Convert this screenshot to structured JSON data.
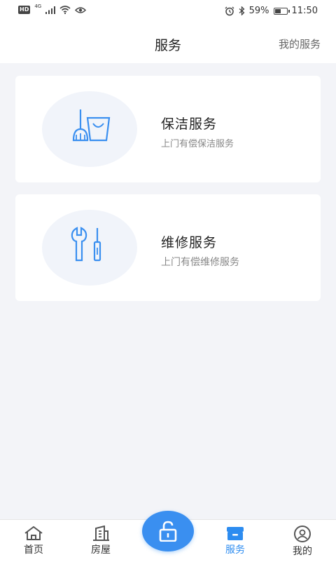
{
  "status_bar": {
    "hd_badge": "HD",
    "network": "4G",
    "battery_percent": "59%",
    "battery_level": 0.59,
    "time": "11:50"
  },
  "header": {
    "title": "服务",
    "action_label": "我的服务"
  },
  "services": [
    {
      "title": "保洁服务",
      "subtitle": "上门有偿保洁服务",
      "icon": "cleaning-icon"
    },
    {
      "title": "维修服务",
      "subtitle": "上门有偿维修服务",
      "icon": "repair-tools-icon"
    }
  ],
  "tab_bar": {
    "items": [
      {
        "label": "首页",
        "icon": "home-icon",
        "active": false
      },
      {
        "label": "房屋",
        "icon": "building-icon",
        "active": false
      },
      {
        "label": "服务",
        "icon": "service-box-icon",
        "active": true
      },
      {
        "label": "我的",
        "icon": "user-icon",
        "active": false
      }
    ],
    "center_icon": "unlock-icon"
  },
  "colors": {
    "accent": "#2d8cf0",
    "background": "#f3f4f8",
    "icon_circle": "#f1f4fa"
  }
}
